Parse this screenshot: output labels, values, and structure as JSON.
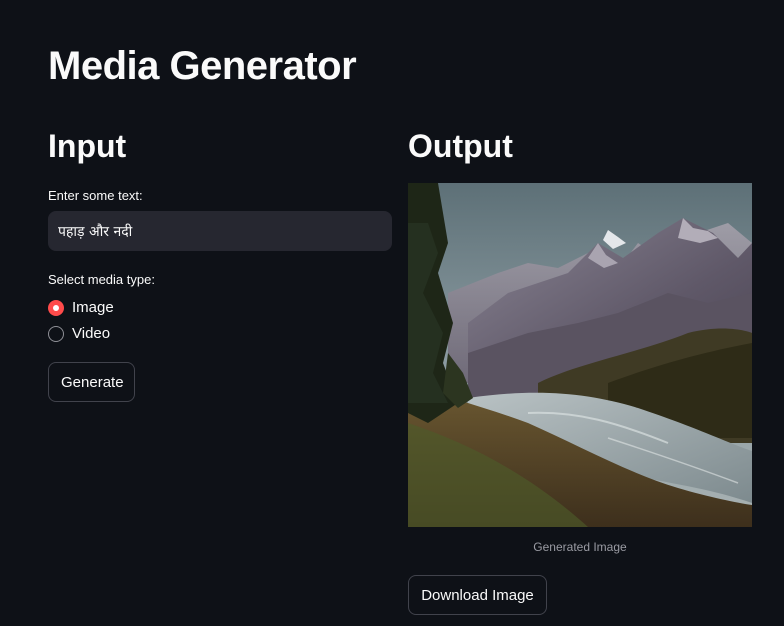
{
  "page": {
    "title": "Media Generator"
  },
  "input_section": {
    "heading": "Input",
    "text_label": "Enter some text:",
    "text_value": "पहाड़ और नदी",
    "media_type_label": "Select media type:",
    "media_options": [
      {
        "label": "Image",
        "selected": true
      },
      {
        "label": "Video",
        "selected": false
      }
    ],
    "generate_label": "Generate"
  },
  "output_section": {
    "heading": "Output",
    "image_caption": "Generated Image",
    "download_label": "Download Image"
  },
  "colors": {
    "background": "#0e1117",
    "input_background": "#262730",
    "accent": "#ff4b4b",
    "text": "#fafafa",
    "caption_text": "#9a9ba3"
  }
}
